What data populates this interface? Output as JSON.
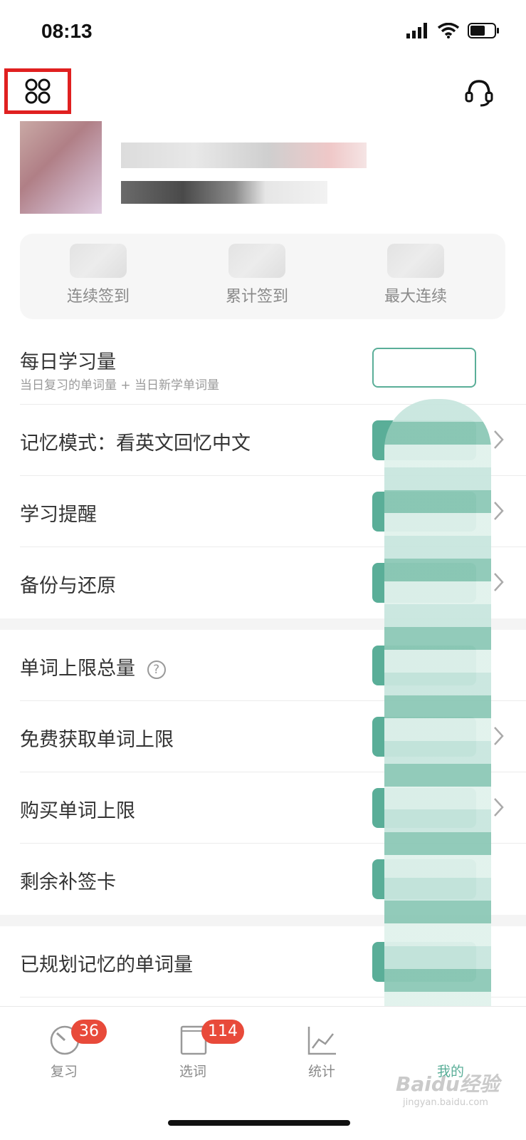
{
  "status_bar": {
    "time": "08:13"
  },
  "stats": [
    {
      "label": "连续签到"
    },
    {
      "label": "累计签到"
    },
    {
      "label": "最大连续"
    }
  ],
  "settings": {
    "daily_amount": {
      "label": "每日学习量",
      "sub": "当日复习的单词量 + 当日新学单词量"
    },
    "memory_mode": {
      "label": "记忆模式：看英文回忆中文"
    },
    "reminder": {
      "label": "学习提醒"
    },
    "backup": {
      "label": "备份与还原"
    },
    "word_limit": {
      "label": "单词上限总量",
      "help": "?"
    },
    "free_limit": {
      "label": "免费获取单词上限"
    },
    "buy_limit": {
      "label": "购买单词上限"
    },
    "makeup_cards": {
      "label": "剩余补签卡"
    },
    "planned_words": {
      "label": "已规划记忆的单词量"
    }
  },
  "tabs": [
    {
      "label": "复习",
      "badge": "36"
    },
    {
      "label": "选词",
      "badge": "114"
    },
    {
      "label": "统计"
    },
    {
      "label": "我的"
    }
  ],
  "watermark": {
    "brand": "Baidu经验",
    "url": "jingyan.baidu.com"
  },
  "colors": {
    "accent": "#5aae98",
    "badge": "#e84a3a",
    "highlight_box": "#e02020"
  }
}
